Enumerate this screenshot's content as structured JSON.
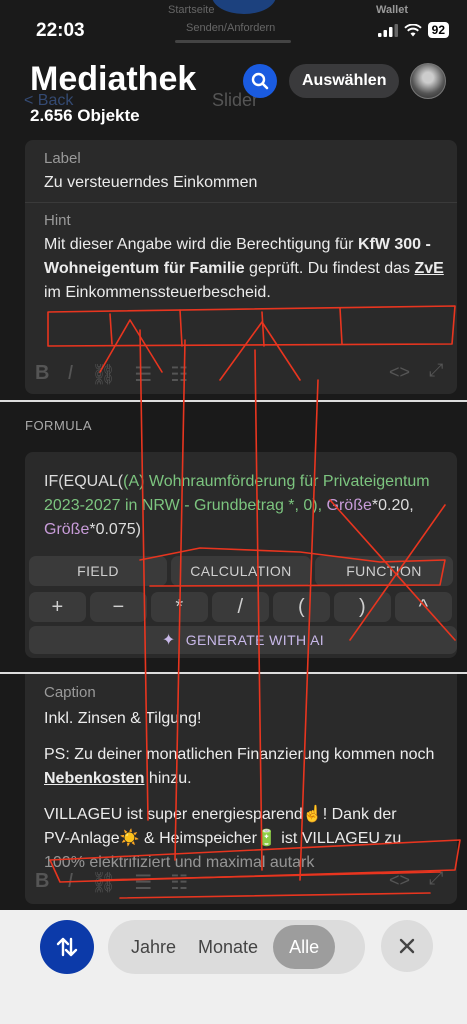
{
  "status_bar": {
    "time": "22:03",
    "battery": "92",
    "ghost_left": "Startseite",
    "ghost_center": "Senden/Anfordern",
    "ghost_right": "Wallet"
  },
  "header": {
    "title": "Mediathek",
    "count": "2.656 Objekte",
    "select_label": "Auswählen",
    "ghost_back": "< Back",
    "ghost_center": "Slider"
  },
  "label_field": {
    "label": "Label",
    "value": "Zu versteuerndes Einkommen"
  },
  "hint_field": {
    "label": "Hint",
    "part1": "Mit dieser Angabe wird die Berechtigung für ",
    "bold1": "KfW 300 - Wohneigentum für Familie",
    "part2": " geprüft. Du findest das ",
    "bold2": "ZvE",
    "part3": " im Einkommenssteuerbescheid."
  },
  "formula": {
    "section_label": "FORMULA",
    "p1": "IF(EQUAL(",
    "p2": "(A) Wohnraumförderung für Privateigentum 2023-2027 in NRW - Grundbetrag",
    "p3": " *, 0), ",
    "p4": "Größe",
    "p5": "*0.20, ",
    "p6": "Größe",
    "p7": "*0.075)",
    "tabs": [
      "FIELD",
      "CALCULATION",
      "FUNCTION"
    ],
    "operators": [
      "+",
      "−",
      "*",
      "/",
      "(",
      ")",
      "^"
    ],
    "generate_label": "GENERATE WITH AI"
  },
  "caption_field": {
    "label": "Caption",
    "line1": "Inkl. Zinsen & Tilgung!",
    "ps_part1": "PS: Zu deiner monatlichen Finanzierung kommen noch ",
    "ps_bold": "Nebenkosten",
    "ps_part2": " hinzu.",
    "villa_line1": "VILLAGEU ist super energiesparend☝️! Dank der",
    "villa_line2": "PV-Anlage☀️ & Heimspeicher🔋 ist VILLAGEU zu",
    "villa_line3": "100% elektrifiziert und maximal autark"
  },
  "bottom_bar": {
    "segments": [
      "Jahre",
      "Monate",
      "Alle"
    ],
    "active": "Alle"
  },
  "colors": {
    "accent_blue": "#1a5be0",
    "sort_blue": "#0c3aa9",
    "formula_green": "#7cc47f",
    "formula_purple": "#c89cd9",
    "scribble_red": "#e8351f"
  }
}
